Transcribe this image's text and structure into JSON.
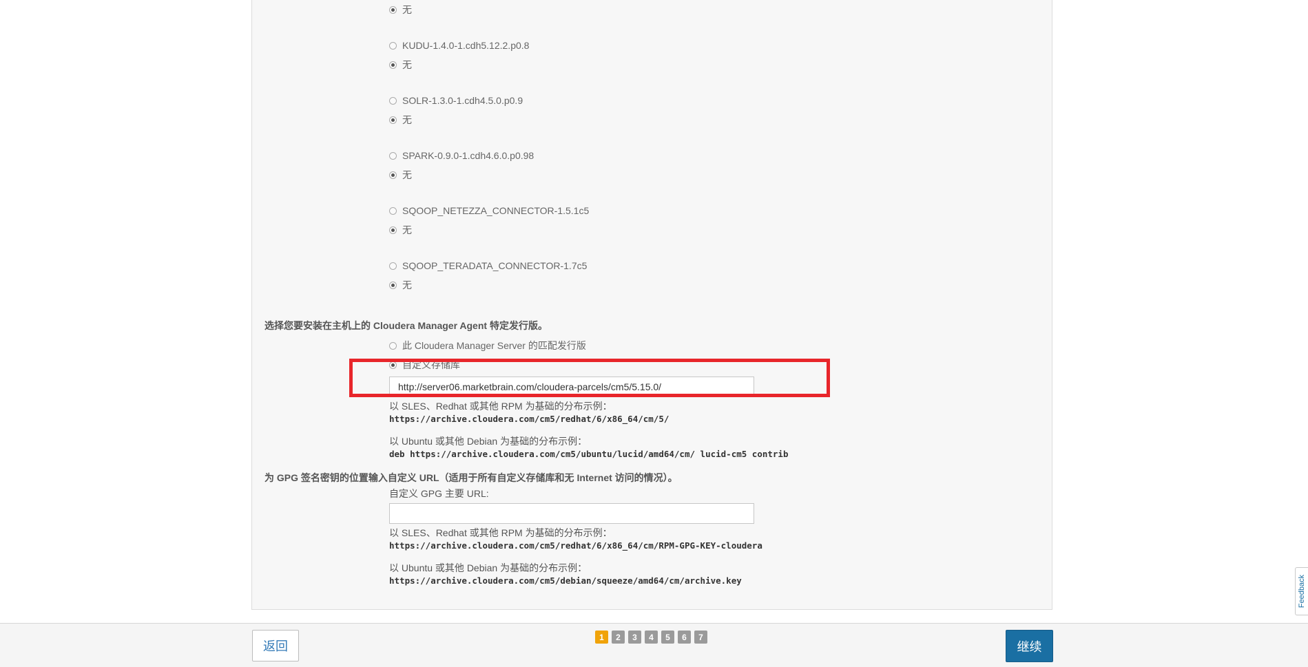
{
  "parcels": [
    {
      "name": null,
      "none_label": "无"
    },
    {
      "name": "KUDU-1.4.0-1.cdh5.12.2.p0.8",
      "none_label": "无"
    },
    {
      "name": "SOLR-1.3.0-1.cdh4.5.0.p0.9",
      "none_label": "无"
    },
    {
      "name": "SPARK-0.9.0-1.cdh4.6.0.p0.98",
      "none_label": "无"
    },
    {
      "name": "SQOOP_NETEZZA_CONNECTOR-1.5.1c5",
      "none_label": "无"
    },
    {
      "name": "SQOOP_TERADATA_CONNECTOR-1.7c5",
      "none_label": "无"
    }
  ],
  "agent": {
    "title": "选择您要安装在主机上的 Cloudera Manager Agent 特定发行版。",
    "option_matching": "此 Cloudera Manager Server 的匹配发行版",
    "option_custom": "自定义存储库",
    "custom_url_value": "http://server06.marketbrain.com/cloudera-parcels/cm5/5.15.0/",
    "sles_example_label": "以 SLES、Redhat 或其他 RPM 为基础的分布示例：",
    "sles_example_url": "https://archive.cloudera.com/cm5/redhat/6/x86_64/cm/5/",
    "ubuntu_example_label": "以 Ubuntu 或其他 Debian 为基础的分布示例：",
    "ubuntu_example_url": "deb https://archive.cloudera.com/cm5/ubuntu/lucid/amd64/cm/ lucid-cm5 contrib"
  },
  "gpg": {
    "title": "为 GPG 签名密钥的位置输入自定义 URL（适用于所有自定义存储库和无 Internet 访问的情况）。",
    "field_label": "自定义 GPG 主要 URL:",
    "field_value": "",
    "sles_example_label": "以 SLES、Redhat 或其他 RPM 为基础的分布示例：",
    "sles_example_url": "https://archive.cloudera.com/cm5/redhat/6/x86_64/cm/RPM-GPG-KEY-cloudera",
    "ubuntu_example_label": "以 Ubuntu 或其他 Debian 为基础的分布示例：",
    "ubuntu_example_url": "https://archive.cloudera.com/cm5/debian/squeeze/amd64/cm/archive.key"
  },
  "footer": {
    "back_label": "返回",
    "continue_label": "继续",
    "pages": [
      "1",
      "2",
      "3",
      "4",
      "5",
      "6",
      "7"
    ],
    "active_page": "1"
  },
  "feedback_label": "Feedback",
  "colors": {
    "highlight": "#e8262b",
    "continue_button": "#1a6fa3",
    "active_page": "#f0a30a",
    "inactive_page": "#9a9a9a"
  }
}
